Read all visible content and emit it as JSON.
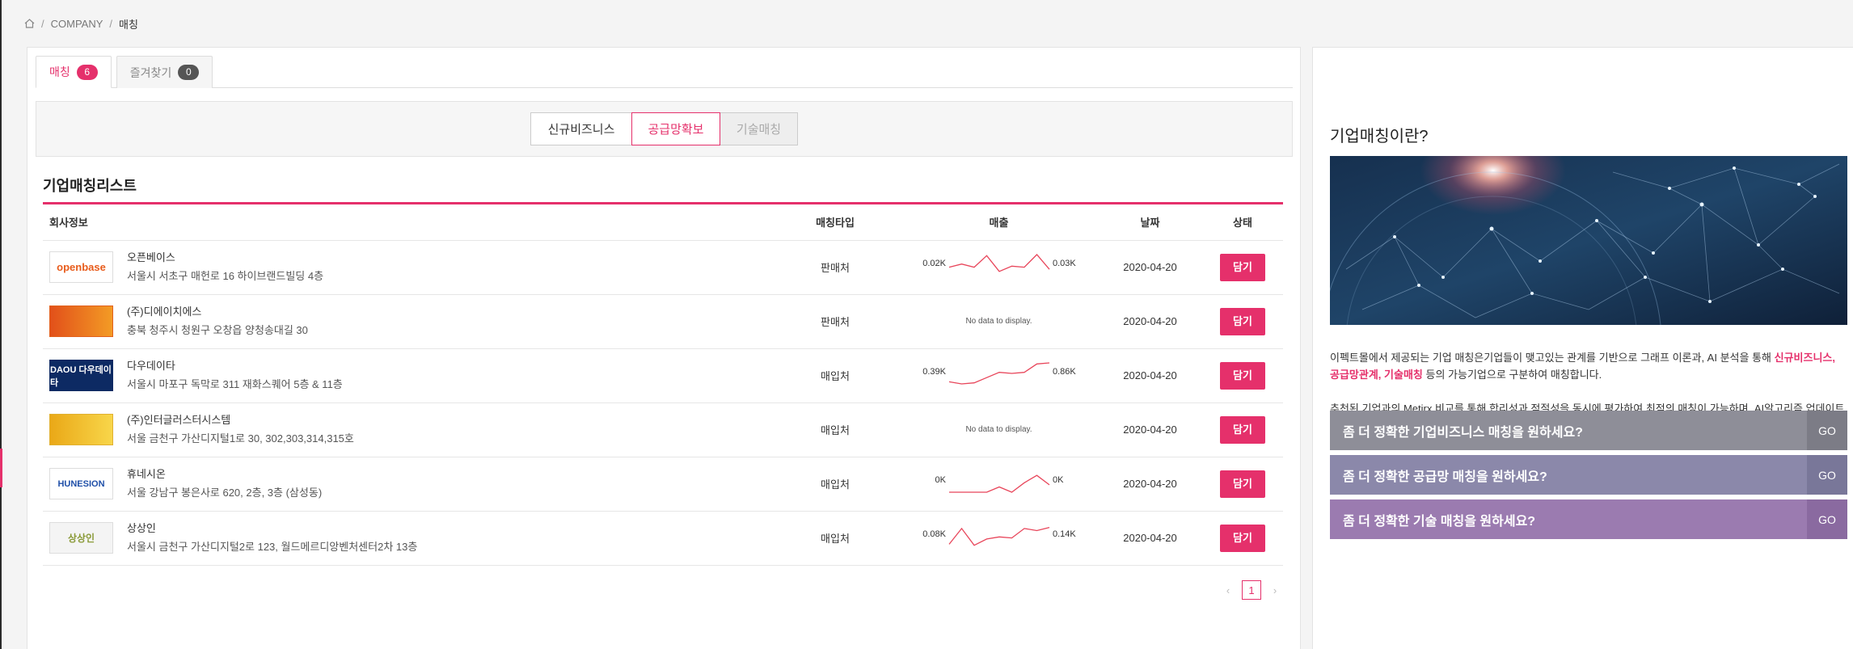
{
  "breadcrumb": {
    "icon": "home-icon",
    "items": [
      "COMPANY",
      "매칭"
    ]
  },
  "tabs": [
    {
      "label": "매칭",
      "count": "6"
    },
    {
      "label": "즐겨찾기",
      "count": "0"
    }
  ],
  "filters": [
    {
      "label": "신규비즈니스",
      "state": "normal"
    },
    {
      "label": "공급망확보",
      "state": "active"
    },
    {
      "label": "기술매칭",
      "state": "disabled"
    }
  ],
  "list": {
    "title": "기업매칭리스트",
    "columns": [
      "회사정보",
      "매칭타입",
      "매출",
      "날짜",
      "상태"
    ],
    "no_data_text": "No data to display.",
    "action_label": "담기",
    "rows": [
      {
        "name": "오픈베이스",
        "address": "서울시 서초구 매헌로 16 하이브랜드빌딩 4층",
        "type": "판매처",
        "logo_text": "openbase",
        "sales": {
          "min_label": "0.02K",
          "max_label": "0.03K",
          "values": [
            0.4,
            0.55,
            0.4,
            0.95,
            0.2,
            0.45,
            0.4,
            1.0,
            0.3
          ]
        },
        "date": "2020-04-20"
      },
      {
        "name": "(주)디에이치에스",
        "address": "충북 청주시 청원구 오창읍 양청송대길 30",
        "type": "판매처",
        "logo_text": "",
        "sales": null,
        "date": "2020-04-20"
      },
      {
        "name": "다우데이타",
        "address": "서울시 마포구 독막로 311 재화스퀘어 5층 & 11층",
        "type": "매입처",
        "logo_text": "DAOU 다우데이타",
        "sales": {
          "min_label": "0.39K",
          "max_label": "0.86K",
          "values": [
            0.1,
            0.0,
            0.05,
            0.3,
            0.55,
            0.5,
            0.55,
            0.95,
            1.0
          ]
        },
        "date": "2020-04-20"
      },
      {
        "name": "(주)인터글러스터시스템",
        "address": "서울 금천구 가산디지털1로 30, 302,303,314,315호",
        "type": "매입처",
        "logo_text": "",
        "sales": null,
        "date": "2020-04-20"
      },
      {
        "name": "휴네시온",
        "address": "서울 강남구 봉은사로 620, 2층, 3층 (삼성동)",
        "type": "매입처",
        "logo_text": "HUNESION",
        "sales": {
          "min_label": "0K",
          "max_label": "0K",
          "values": [
            0.0,
            0.0,
            0.0,
            0.0,
            0.25,
            0.0,
            0.45,
            0.8,
            0.35
          ]
        },
        "date": "2020-04-20"
      },
      {
        "name": "상상인",
        "address": "서울시 금천구 가산디지털2로 123, 월드메르디앙벤처센터2차 13층",
        "type": "매입처",
        "logo_text": "상상인",
        "sales": {
          "min_label": "0.08K",
          "max_label": "0.14K",
          "values": [
            0.1,
            0.85,
            0.05,
            0.35,
            0.45,
            0.4,
            0.85,
            0.75,
            0.9
          ]
        },
        "date": "2020-04-20"
      }
    ]
  },
  "pagination": {
    "prev": "‹",
    "current": "1",
    "next": "›"
  },
  "sidebar": {
    "title": "기업매칭이란?",
    "desc1_parts": [
      "이펙트몰에서 제공되는 기업 매칭은기업들이 맺고있는 관계를 기반으로 그래프 이론과, AI 분석을 통해 ",
      "신규비즈니스, 공급망관계, 기술매칭",
      " 등의 가능기업으로 구분하여 매칭합니다."
    ],
    "desc2": "추천된 기업과의 Metirx 비교를 통해 합리성과 적절성을 동시에 평가하여 최적의 매칭이 가능하며, AI알고리즘 업데이트를 통해 계속 발전합니다.",
    "cta": [
      {
        "label": "좀 더 정확한 기업비즈니스 매칭을 원하세요?",
        "go": "GO"
      },
      {
        "label": "좀 더 정확한 공급망 매칭을 원하세요?",
        "go": "GO"
      },
      {
        "label": "좀 더 정확한 기술 매칭을 원하세요?",
        "go": "GO"
      }
    ]
  },
  "colors": {
    "accent": "#e5306b",
    "spark_line": "#e8455a"
  }
}
